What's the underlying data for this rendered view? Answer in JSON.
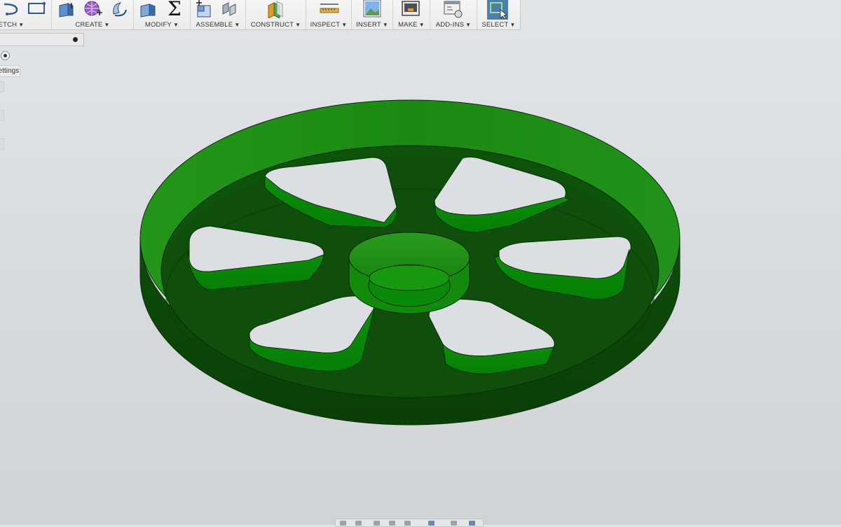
{
  "toolbar": {
    "groups": [
      {
        "id": "sketch",
        "label": "KETCH"
      },
      {
        "id": "create",
        "label": "CREATE"
      },
      {
        "id": "modify",
        "label": "MODIFY"
      },
      {
        "id": "assemble",
        "label": "ASSEMBLE"
      },
      {
        "id": "construct",
        "label": "CONSTRUCT"
      },
      {
        "id": "inspect",
        "label": "INSPECT"
      },
      {
        "id": "insert",
        "label": "INSERT"
      },
      {
        "id": "make",
        "label": "MAKE"
      },
      {
        "id": "addins",
        "label": "ADD-INS"
      },
      {
        "id": "select",
        "label": "SELECT"
      }
    ],
    "caret": "▼",
    "sigma": "Σ"
  },
  "side_panel": {
    "settings_label": "Settings"
  },
  "model": {
    "type": "pulley-wheel",
    "body_color": "#1f8a12",
    "dark_color": "#0f4d0a",
    "spoke_count": 6
  },
  "colors": {
    "accent_select": "#4a7fb0",
    "background_top": "#e2e5e8"
  }
}
